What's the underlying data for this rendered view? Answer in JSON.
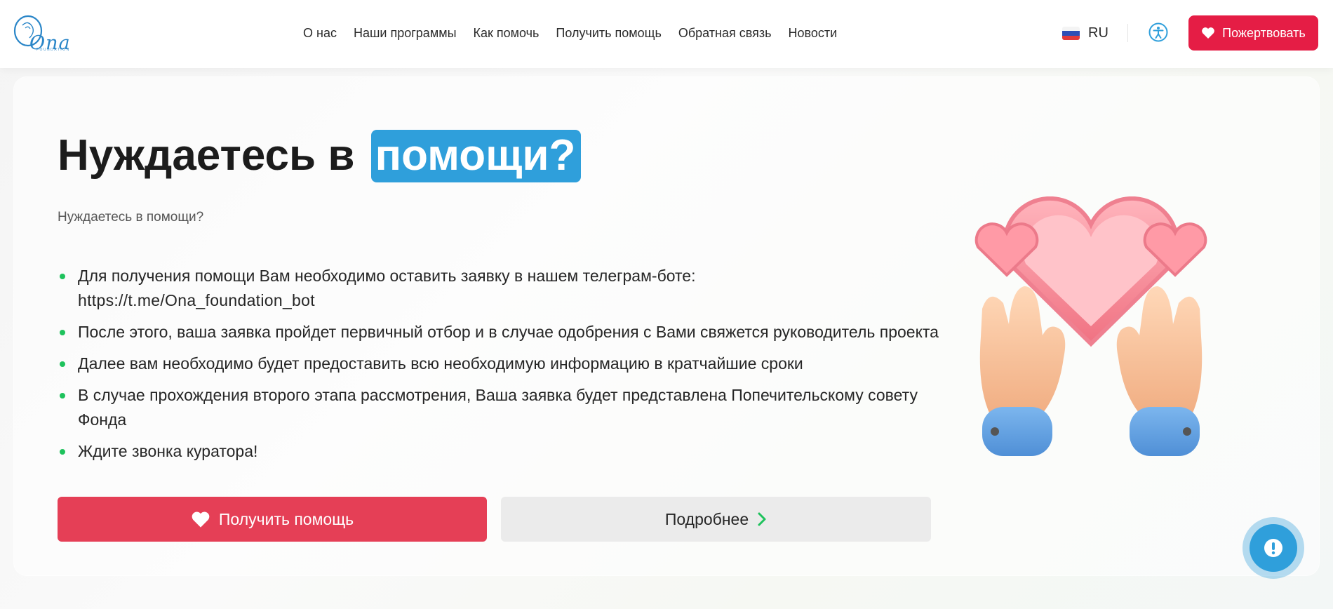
{
  "header": {
    "logo": {
      "text": "Ona",
      "subtext": "FOUNDATION"
    },
    "nav": [
      {
        "label": "О нас"
      },
      {
        "label": "Наши программы"
      },
      {
        "label": "Как помочь"
      },
      {
        "label": "Получить помощь"
      },
      {
        "label": "Обратная связь"
      },
      {
        "label": "Новости"
      }
    ],
    "language": {
      "code": "RU",
      "flag": "russia-flag-icon"
    },
    "accessibility_icon": "accessibility-icon",
    "donate_label": "Пожертвовать"
  },
  "hero": {
    "title_plain": "Нуждаетесь в ",
    "title_highlight": "помощи?",
    "subtitle": "Нуждаетесь в помощи?",
    "steps": [
      {
        "text": "Для получения помощи Вам необходимо оставить заявку в нашем телеграм-боте:",
        "link": "https://t.me/Ona_foundation_bot"
      },
      {
        "text": "После этого, ваша заявка пройдет первичный отбор и в случае одобрения с Вами свяжется руководитель проекта"
      },
      {
        "text": "Далее вам необходимо будет предоставить всю необходимую информацию в кратчайшие сроки"
      },
      {
        "text": "В случае прохождения второго этапа рассмотрения, Ваша заявка будет представлена Попечительскому совету Фонда"
      },
      {
        "text": "Ждите звонка куратора!"
      }
    ],
    "primary_button": "Получить помощь",
    "secondary_button": "Подробнее",
    "illustration": "heart-in-hands-icon"
  },
  "colors": {
    "brand_red": "#e51d45",
    "button_red": "#e53f56",
    "highlight_blue": "#2f9fdb",
    "bullet_green": "#1ec25c"
  }
}
